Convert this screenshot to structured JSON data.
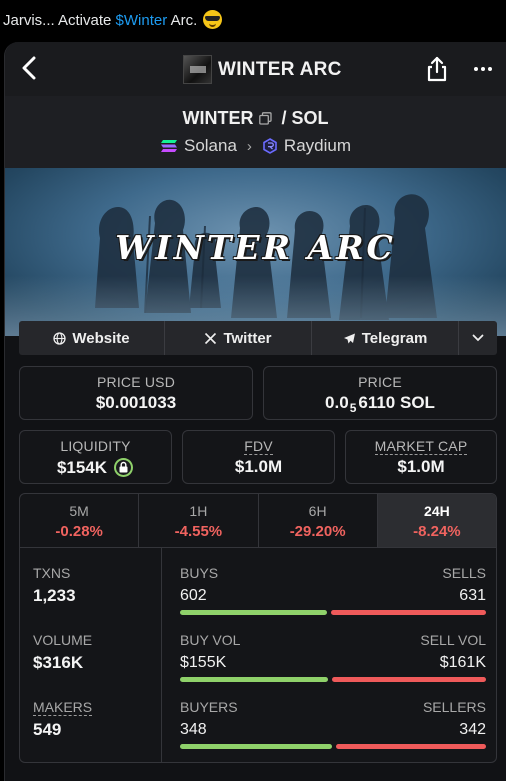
{
  "tweet": {
    "prefix": "Jarvis... Activate ",
    "cashtag": "$Winter",
    "suffix": " Arc."
  },
  "header": {
    "title": "WINTER ARC"
  },
  "pair": {
    "base": "WINTER",
    "separator": " / ",
    "quote": "SOL",
    "chain": "Solana",
    "dex": "Raydium"
  },
  "banner": {
    "title": "WINTER ARC"
  },
  "links": {
    "website": "Website",
    "twitter": "Twitter",
    "telegram": "Telegram"
  },
  "price": {
    "usd_label": "PRICE USD",
    "usd_value": "$0.001033",
    "native_label": "PRICE",
    "native_prefix": "0.0",
    "native_sub": "5",
    "native_rest": "6110 SOL"
  },
  "metrics": {
    "liquidity_label": "LIQUIDITY",
    "liquidity_value": "$154K",
    "fdv_label": "FDV",
    "fdv_value": "$1.0M",
    "mcap_label": "MARKET CAP",
    "mcap_value": "$1.0M"
  },
  "timeframes": [
    {
      "label": "5M",
      "change": "-0.28%"
    },
    {
      "label": "1H",
      "change": "-4.55%"
    },
    {
      "label": "6H",
      "change": "-29.20%"
    },
    {
      "label": "24H",
      "change": "-8.24%"
    }
  ],
  "active_timeframe": "24H",
  "stats": {
    "txns_label": "TXNS",
    "txns_value": "1,233",
    "volume_label": "VOLUME",
    "volume_value": "$316K",
    "makers_label": "MAKERS",
    "makers_value": "549",
    "buys_label": "BUYS",
    "buys_value": "602",
    "sells_label": "SELLS",
    "sells_value": "631",
    "buyvol_label": "BUY VOL",
    "buyvol_value": "$155K",
    "sellvol_label": "SELL VOL",
    "sellvol_value": "$161K",
    "buyers_label": "BUYERS",
    "buyers_value": "348",
    "sellers_label": "SELLERS",
    "sellers_value": "342"
  },
  "ratios": {
    "buys_share": 0.488,
    "buyvol_share": 0.49,
    "buyers_share": 0.504
  },
  "colors": {
    "buy": "#8fd16a",
    "sell": "#ef5a5a",
    "negative": "#f0635f",
    "link": "#1d9bf0"
  }
}
